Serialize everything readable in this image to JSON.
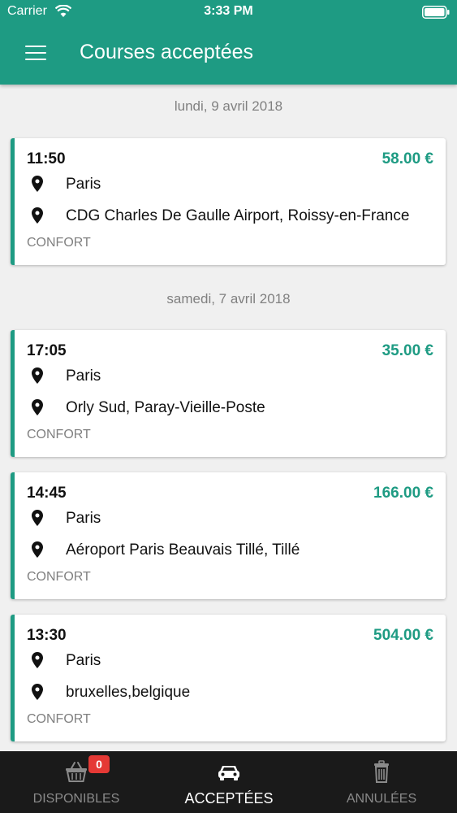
{
  "status_bar": {
    "carrier": "Carrier",
    "time": "3:33 PM"
  },
  "header": {
    "title": "Courses acceptées"
  },
  "groups": [
    {
      "date": "lundi, 9 avril 2018"
    },
    {
      "date": "samedi, 7 avril 2018"
    }
  ],
  "rides": [
    {
      "time": "11:50",
      "price": "58.00 €",
      "from": "Paris",
      "to": "CDG Charles De Gaulle Airport, Roissy-en-France",
      "type": "CONFORT"
    },
    {
      "time": "17:05",
      "price": "35.00 €",
      "from": "Paris",
      "to": "Orly Sud, Paray-Vieille-Poste",
      "type": "CONFORT"
    },
    {
      "time": "14:45",
      "price": "166.00 €",
      "from": "Paris",
      "to": "Aéroport Paris Beauvais Tillé, Tillé",
      "type": "CONFORT"
    },
    {
      "time": "13:30",
      "price": "504.00 €",
      "from": "Paris",
      "to": "bruxelles,belgique",
      "type": "CONFORT"
    }
  ],
  "tabs": [
    {
      "label": "DISPONIBLES",
      "badge": "0",
      "icon": "basket-icon"
    },
    {
      "label": "ACCEPTÉES",
      "icon": "car-icon",
      "active": true
    },
    {
      "label": "ANNULÉES",
      "icon": "trash-icon"
    }
  ],
  "colors": {
    "primary": "#1e9b83",
    "badge": "#e53935",
    "tabbar": "#1a1a1a"
  }
}
